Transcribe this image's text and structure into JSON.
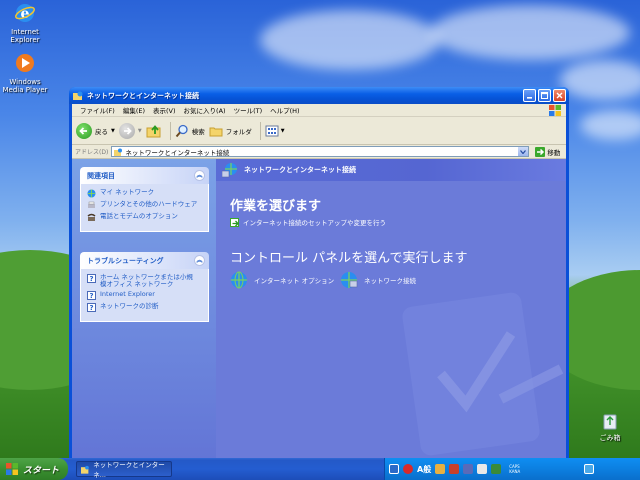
{
  "desktop": {
    "icons": [
      {
        "label": "Internet\nExplorer",
        "icon": "internet-explorer-icon"
      },
      {
        "label": "Windows\nMedia Player",
        "icon": "media-player-icon"
      }
    ],
    "recycle_bin": {
      "label": "ごみ箱",
      "icon": "recycle-bin-icon"
    }
  },
  "window": {
    "title": "ネットワークとインターネット接続",
    "menu": [
      "ファイル(F)",
      "編集(E)",
      "表示(V)",
      "お気に入り(A)",
      "ツール(T)",
      "ヘルプ(H)"
    ],
    "toolbar": {
      "back": "戻る",
      "search": "検索",
      "folders": "フォルダ"
    },
    "address": {
      "label": "アドレス(D)",
      "value": "ネットワークとインターネット接続",
      "go": "移動"
    }
  },
  "left_pane": {
    "related": {
      "title": "関連項目",
      "items": [
        {
          "label": "マイ ネットワーク",
          "icon": "network-globe-icon"
        },
        {
          "label": "プリンタとその他のハードウェア",
          "icon": "printer-icon"
        },
        {
          "label": "電話とモデムのオプション",
          "icon": "phone-icon"
        }
      ]
    },
    "troubleshooting": {
      "title": "トラブルシューティング",
      "items": [
        {
          "label": "ホーム ネットワークまたは小規\n模オフィス ネットワーク",
          "icon": "help-icon"
        },
        {
          "label": "Internet Explorer",
          "icon": "help-icon"
        },
        {
          "label": "ネットワークの診断",
          "icon": "help-icon"
        }
      ]
    }
  },
  "right_pane": {
    "header": "ネットワークとインターネット接続",
    "pick_task_title": "作業を選びます",
    "task_link": "インターネット接続のセットアップや変更を行う",
    "pick_cp_title": "コントロール パネルを選んで実行します",
    "cp_icons": [
      {
        "label": "インターネット オプション",
        "icon": "internet-options-icon"
      },
      {
        "label": "ネットワーク接続",
        "icon": "network-connections-icon"
      }
    ]
  },
  "taskbar": {
    "start_label": "スタート",
    "task_button": "ネットワークとインターネ...",
    "ime_text": "A般",
    "caps": [
      "CAPS",
      "KANA"
    ]
  },
  "colors": {
    "window_blue": "#0a50d8",
    "right_pane": "#6b7bd9",
    "task_link_text": "#215dc6",
    "start_green": "#3a8f30"
  }
}
